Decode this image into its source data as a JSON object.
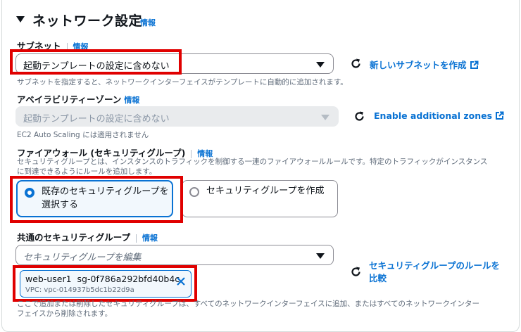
{
  "section": {
    "title": "ネットワーク設定",
    "info": "情報"
  },
  "subnet": {
    "label": "サブネット",
    "info": "情報",
    "value": "起動テンプレートの設定に含めない",
    "create_link": "新しいサブネットを作成",
    "description": "サブネットを指定すると、ネットワークインターフェイスがテンプレートに自動的に追加されます。"
  },
  "az": {
    "label": "アベイラビリティーゾーン",
    "info": "情報",
    "value": "起動テンプレートの設定に含めない",
    "enable_link": "Enable additional zones",
    "description": "EC2 Auto Scaling には適用されません"
  },
  "firewall": {
    "label": "ファイアウォール (セキュリティグループ)",
    "info": "情報",
    "description_line1": "セキュリティグループとは、インスタンスのトラフィックを制御する一連のファイアウォールルールです。特定のトラフィックがインスタンス",
    "description_line2": "に到達できるようにルールを追加します。",
    "option_existing_line1": "既存のセキュリティグループを",
    "option_existing_line2": "選択する",
    "option_create": "セキュリティグループを作成",
    "selected": "existing"
  },
  "common_sg": {
    "label": "共通のセキュリティグループ",
    "info": "情報",
    "placeholder": "セキュリティグループを編集",
    "compare_link_line1": "セキュリティグループのルールを",
    "compare_link_line2": "比較",
    "token": {
      "name": "web-user1",
      "id": "sg-0f786a292bfd40b4c",
      "vpc": "VPC: vpc-014937b5dc1b22d9a"
    },
    "description_line1": "ここで追加または削除したセキュリティグループは、すべてのネットワークインターフェイスに追加、またはすべてのネットワークインター",
    "description_line2": "フェイスから削除されます。"
  },
  "colors": {
    "accent": "#0972d3",
    "highlight": "#e00000",
    "text": "#0f141a",
    "muted": "#5f6b7a"
  },
  "icons": {
    "caret": "triangle-down-icon",
    "refresh": "refresh-icon",
    "external": "external-link-icon",
    "remove": "close-icon"
  }
}
